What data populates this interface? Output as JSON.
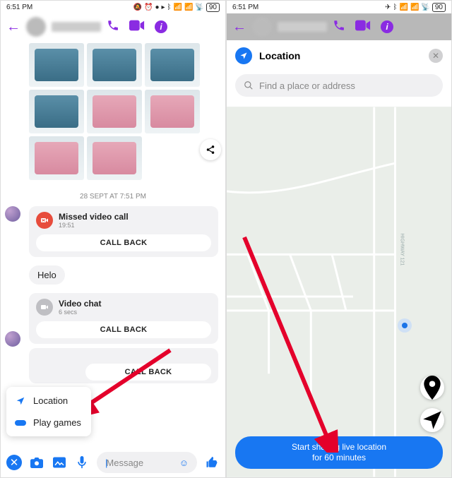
{
  "status": {
    "time": "6:51 PM",
    "battery": "90"
  },
  "header": {
    "call_icon": "call-icon",
    "video_icon": "video-icon",
    "info_icon": "info-icon"
  },
  "chat": {
    "timestamp": "28 SEPT AT 7:51 PM",
    "missed": {
      "title": "Missed video call",
      "time": "19:51",
      "button": "CALL BACK"
    },
    "hello": "Helo",
    "videochat": {
      "title": "Video chat",
      "sub": "6 secs",
      "button": "CALL BACK"
    },
    "third_button": "CALL BACK"
  },
  "popup": {
    "location": "Location",
    "games": "Play games"
  },
  "composer": {
    "placeholder": "Message"
  },
  "location_panel": {
    "title": "Location",
    "search_placeholder": "Find a place or address",
    "share_line1": "Start sharing live location",
    "share_line2": "for 60 minutes",
    "road_label": "HIGHWAY 121"
  }
}
